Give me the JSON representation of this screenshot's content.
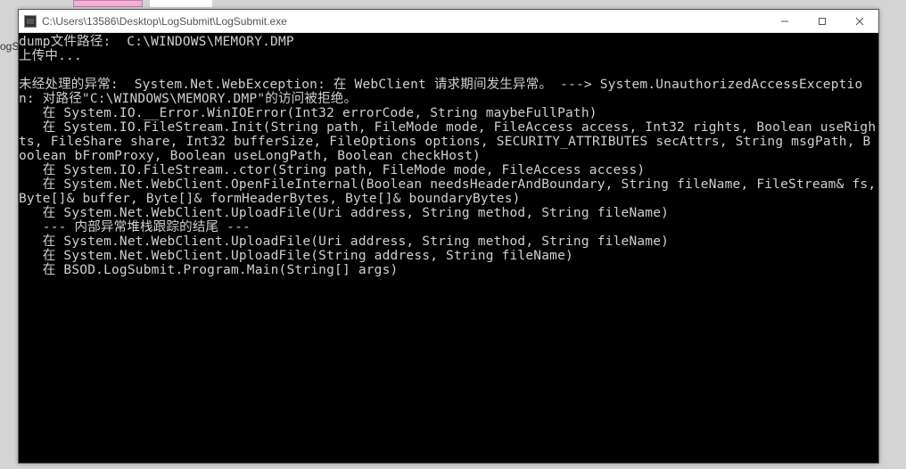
{
  "left_strip_text": "ogS",
  "window": {
    "title": "C:\\Users\\13586\\Desktop\\LogSubmit\\LogSubmit.exe",
    "controls": {
      "minimize": "minimize",
      "maximize": "maximize",
      "close": "close"
    }
  },
  "console": {
    "lines": [
      "dump文件路径:  C:\\WINDOWS\\MEMORY.DMP",
      "上传中...",
      "",
      "未经处理的异常:  System.Net.WebException: 在 WebClient 请求期间发生异常。 ---> System.UnauthorizedAccessException: 对路径\"C:\\WINDOWS\\MEMORY.DMP\"的访问被拒绝。",
      "   在 System.IO.__Error.WinIOError(Int32 errorCode, String maybeFullPath)",
      "   在 System.IO.FileStream.Init(String path, FileMode mode, FileAccess access, Int32 rights, Boolean useRights, FileShare share, Int32 bufferSize, FileOptions options, SECURITY_ATTRIBUTES secAttrs, String msgPath, Boolean bFromProxy, Boolean useLongPath, Boolean checkHost)",
      "   在 System.IO.FileStream..ctor(String path, FileMode mode, FileAccess access)",
      "   在 System.Net.WebClient.OpenFileInternal(Boolean needsHeaderAndBoundary, String fileName, FileStream& fs, Byte[]& buffer, Byte[]& formHeaderBytes, Byte[]& boundaryBytes)",
      "   在 System.Net.WebClient.UploadFile(Uri address, String method, String fileName)",
      "   --- 内部异常堆栈跟踪的结尾 ---",
      "   在 System.Net.WebClient.UploadFile(Uri address, String method, String fileName)",
      "   在 System.Net.WebClient.UploadFile(String address, String fileName)",
      "   在 BSOD.LogSubmit.Program.Main(String[] args)"
    ]
  }
}
